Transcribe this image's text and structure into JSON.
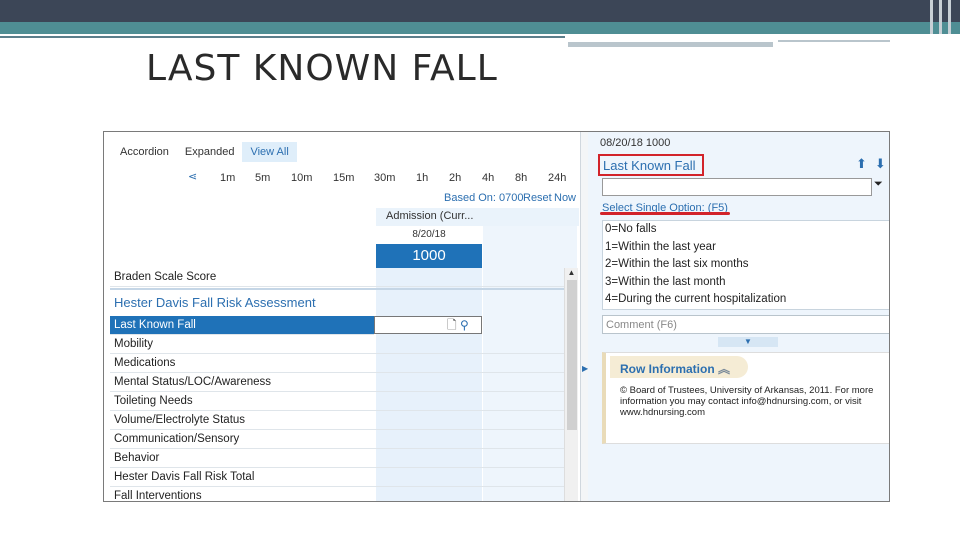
{
  "slide": {
    "title": "LAST KNOWN FALL"
  },
  "colors": {
    "accent": "#1f72b8",
    "highlight_red": "#d2232a",
    "slide_top": "#3c4657",
    "slide_band": "#4f8e94"
  },
  "view_tabs": [
    "Accordion",
    "Expanded",
    "View All"
  ],
  "time_scale": [
    "1m",
    "5m",
    "10m",
    "15m",
    "30m",
    "1h",
    "2h",
    "4h",
    "8h",
    "24h"
  ],
  "controls": {
    "based_on": "Based On: 0700",
    "reset": "Reset",
    "now": "Now"
  },
  "column": {
    "header": "Admission (Curr...",
    "date": "8/20/18",
    "time": "1000"
  },
  "rows": {
    "braden": "Braden Scale Score",
    "section": "Hester Davis Fall Risk Assessment",
    "items": [
      "Last Known Fall",
      "Mobility",
      "Medications",
      "Mental Status/LOC/Awareness",
      "Toileting Needs",
      "Volume/Electrolyte Status",
      "Communication/Sensory",
      "Behavior",
      "Hester Davis Fall Risk Total",
      "Fall Interventions"
    ]
  },
  "detail": {
    "datetime": "08/20/18 1000",
    "title": "Last Known Fall",
    "select_label": "Select Single Option: (F5)",
    "options": [
      "0=No falls",
      "1=Within the last year",
      "2=Within the last six months",
      "3=Within the last month",
      "4=During the current hospitalization"
    ],
    "comment_placeholder": "Comment (F6)",
    "row_info_label": "Row Information",
    "row_info_text": "© Board of Trustees, University of Arkansas, 2011. For more information you may contact info@hdnursing.com, or visit www.hdnursing.com"
  }
}
